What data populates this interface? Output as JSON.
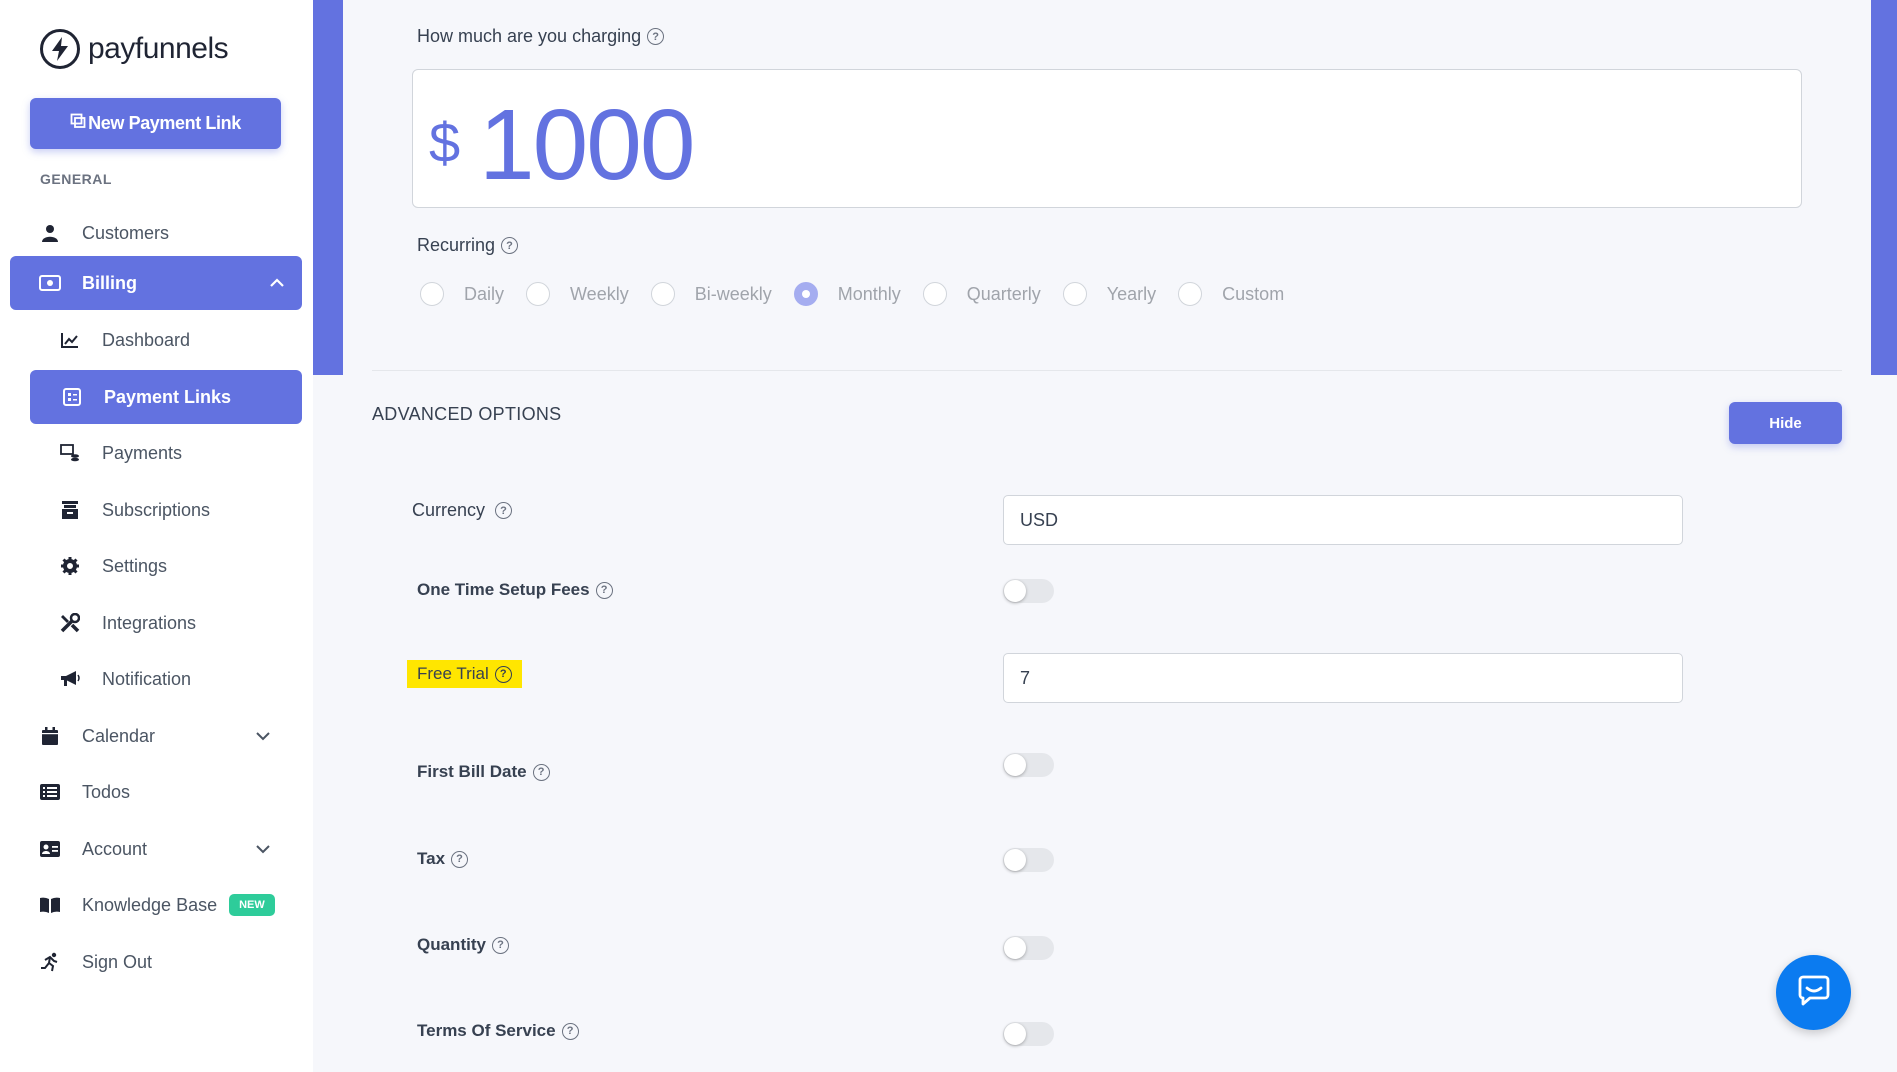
{
  "brand": {
    "name": "payfunnels",
    "accent": "#6372e0"
  },
  "sidebar": {
    "new_link_label": "New Payment Link",
    "section_label": "GENERAL",
    "items": [
      {
        "label": "Customers",
        "icon": "user-icon"
      },
      {
        "label": "Billing",
        "icon": "money-icon"
      },
      {
        "label": "Dashboard",
        "icon": "chart-line-icon"
      },
      {
        "label": "Payment Links",
        "icon": "link-list-icon"
      },
      {
        "label": "Payments",
        "icon": "payments-icon"
      },
      {
        "label": "Subscriptions",
        "icon": "archive-icon"
      },
      {
        "label": "Settings",
        "icon": "gear-icon"
      },
      {
        "label": "Integrations",
        "icon": "tools-icon"
      },
      {
        "label": "Notification",
        "icon": "megaphone-icon"
      },
      {
        "label": "Calendar",
        "icon": "calendar-icon"
      },
      {
        "label": "Todos",
        "icon": "list-icon"
      },
      {
        "label": "Account",
        "icon": "id-card-icon"
      },
      {
        "label": "Knowledge Base",
        "icon": "book-icon",
        "badge": "NEW"
      },
      {
        "label": "Sign Out",
        "icon": "running-icon"
      }
    ]
  },
  "pricing": {
    "charging_label": "How much are you charging",
    "currency_symbol": "$",
    "amount": "1000",
    "recurring_label": "Recurring",
    "options": [
      "Daily",
      "Weekly",
      "Bi-weekly",
      "Monthly",
      "Quarterly",
      "Yearly",
      "Custom"
    ],
    "selected": "Monthly"
  },
  "advanced": {
    "title": "ADVANCED OPTIONS",
    "hide_label": "Hide",
    "currency_label": "Currency",
    "currency_value": "USD",
    "setup_fees_label": "One Time Setup Fees",
    "free_trial_label": "Free Trial",
    "free_trial_value": "7",
    "first_bill_label": "First Bill Date",
    "tax_label": "Tax",
    "quantity_label": "Quantity",
    "tos_label": "Terms Of Service"
  }
}
